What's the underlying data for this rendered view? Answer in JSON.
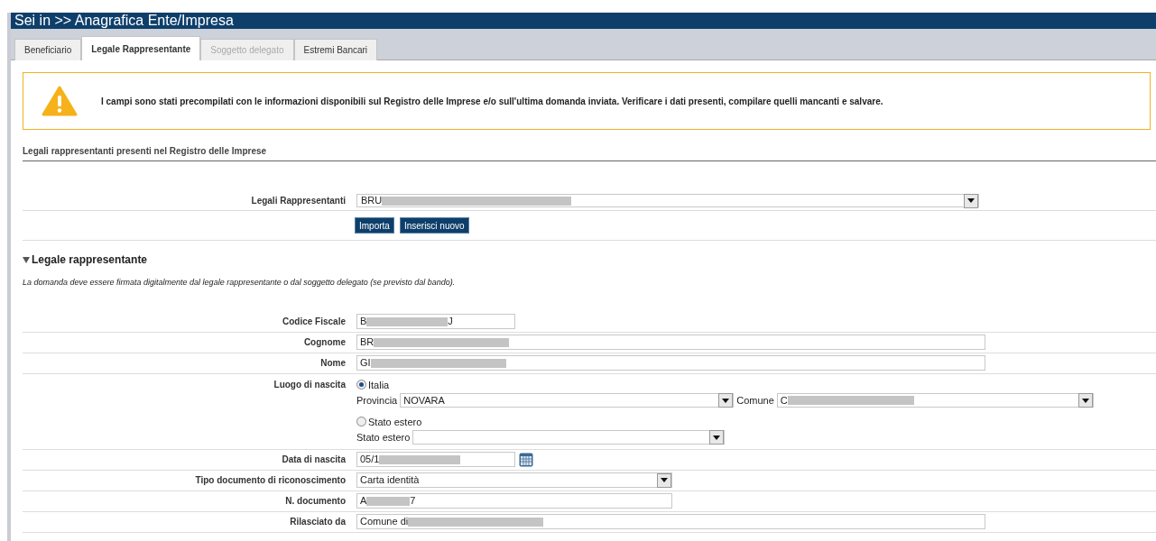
{
  "header": {
    "title": "Sei in >> Anagrafica Ente/Impresa"
  },
  "tabs": [
    {
      "label": "Beneficiario",
      "selected": false,
      "disabled": false
    },
    {
      "label": "Legale Rappresentante",
      "selected": true,
      "disabled": false
    },
    {
      "label": "Soggetto delegato",
      "selected": false,
      "disabled": true
    },
    {
      "label": "Estremi Bancari",
      "selected": false,
      "disabled": false
    }
  ],
  "alert": {
    "message": "I campi sono stati precompilati con le informazioni disponibili sul Registro delle Imprese e/o sull'ultima domanda inviata. Verificare i dati presenti, compilare quelli mancanti e salvare."
  },
  "registry": {
    "heading": "Legali rappresentanti presenti nel Registro delle Imprese",
    "label": "Legali Rappresentanti",
    "value_start": "BRU",
    "redacted": true,
    "buttons": [
      "Importa",
      "Inserisci nuovo"
    ]
  },
  "section": {
    "title": "Legale rappresentante",
    "expanded": true,
    "note": "La domanda deve essere firmata digitalmente dal legale rappresentante o dal soggetto delegato (se previsto dal bando)."
  },
  "rows": [
    {
      "kind": "short_text",
      "label": "Codice Fiscale",
      "value_start": "B",
      "value_end": "J",
      "redacted": true
    },
    {
      "kind": "long_text",
      "label": "Cognome",
      "value_start": "BR",
      "redacted": true
    },
    {
      "kind": "long_text",
      "label": "Nome",
      "value_start": "GI",
      "redacted": true
    },
    {
      "kind": "birthplace",
      "label": "Luogo di nascita",
      "options": [
        {
          "label": "Italia",
          "selected": true
        },
        {
          "label": "Stato estero",
          "selected": false
        }
      ],
      "provincia": {
        "label": "Provincia",
        "value": "NOVARA"
      },
      "comune": {
        "label": "Comune",
        "value_start": "C",
        "redacted": true
      },
      "stato": {
        "label": "Stato estero"
      }
    },
    {
      "kind": "date",
      "label": "Data di nascita",
      "value_start": "05/1",
      "redacted": true
    },
    {
      "kind": "select",
      "label": "Tipo documento di riconoscimento",
      "value_start": "Carta identità"
    },
    {
      "kind": "medium_text",
      "label": "N. documento",
      "value_start": "A",
      "value_end": "7",
      "redacted": true
    },
    {
      "kind": "long_text",
      "label": "Rilasciato da",
      "value_start": "Comune di",
      "redacted": true
    }
  ]
}
